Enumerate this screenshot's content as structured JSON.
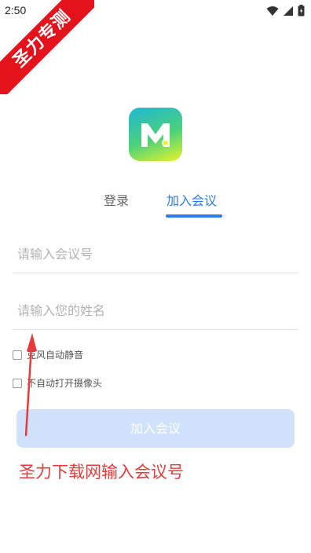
{
  "status_bar": {
    "time": "2:50"
  },
  "watermark": {
    "text": "圣力专测"
  },
  "tabs": {
    "login": "登录",
    "join": "加入会议"
  },
  "form": {
    "meeting_id_placeholder": "请输入会议号",
    "name_placeholder": "请输入您的姓名",
    "mute_mic_label": "克风自动静音",
    "camera_off_label": "不自动打开摄像头",
    "join_button": "加入会议"
  },
  "annotation": {
    "caption": "圣力下载网输入会议号"
  },
  "colors": {
    "accent": "#2a7cf5",
    "ribbon": "#e4121b",
    "caption": "#e83a3a",
    "button_disabled": "#d0e2fb"
  }
}
